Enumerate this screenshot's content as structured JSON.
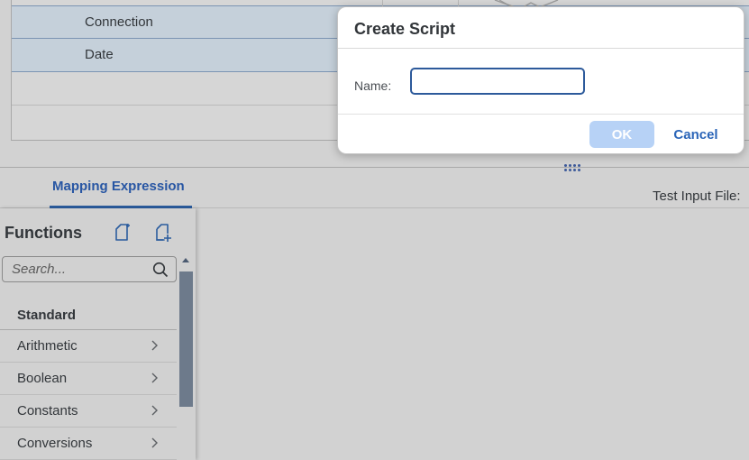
{
  "table": {
    "rows": [
      "Connection",
      "Date",
      "",
      ""
    ]
  },
  "tabs": {
    "mapping_expression": "Mapping Expression"
  },
  "test_input": {
    "label": "Test Input File:"
  },
  "functions": {
    "title": "Functions",
    "icons": [
      "new-script-icon",
      "add-function-icon"
    ],
    "search_placeholder": "Search...",
    "group": "Standard",
    "items": [
      "Arithmetic",
      "Boolean",
      "Constants",
      "Conversions"
    ]
  },
  "dialog": {
    "title": "Create Script",
    "name_label": "Name:",
    "name_value": "",
    "ok_label": "OK",
    "cancel_label": "Cancel"
  },
  "colors": {
    "accent": "#2b5c9e",
    "ok_disabled": "#b7d2f6",
    "selected_row": "#c5d0da"
  }
}
